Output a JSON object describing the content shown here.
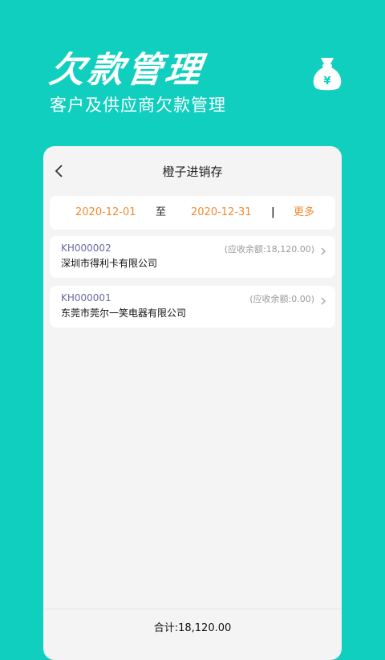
{
  "hero": {
    "title": "欠款管理",
    "subtitle": "客户及供应商欠款管理",
    "icon": "money-bag-icon",
    "currency_symbol": "¥"
  },
  "app": {
    "title": "橙子进销存",
    "back_icon": "chevron-left-icon"
  },
  "filter": {
    "start_date": "2020-12-01",
    "to_label": "至",
    "end_date": "2020-12-31",
    "divider": "|",
    "more_label": "更多"
  },
  "records": [
    {
      "code": "KH000002",
      "name": "深圳市得利卡有限公司",
      "balance": "(应收余额:18,120.00)"
    },
    {
      "code": "KH000001",
      "name": "东莞市莞尔一笑电器有限公司",
      "balance": "(应收余额:0.00)"
    }
  ],
  "footer": {
    "total": "合计:18,120.00"
  },
  "colors": {
    "background": "#10CFBE",
    "accent_orange": "#F08A33",
    "card": "#FFFFFF",
    "panel": "#F4F4F4"
  }
}
